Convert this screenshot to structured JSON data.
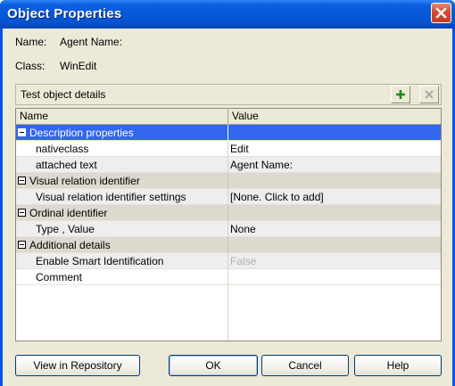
{
  "window": {
    "title": "Object Properties"
  },
  "info": {
    "name_label": "Name:",
    "name_value": "Agent Name:",
    "class_label": "Class:",
    "class_value": "WinEdit"
  },
  "panel": {
    "title": "Test object details",
    "add_icon": "plus-icon",
    "remove_icon": "x-icon"
  },
  "grid": {
    "columns": [
      "Name",
      "Value"
    ],
    "rows": [
      {
        "type": "category",
        "name": "Description properties",
        "value": ""
      },
      {
        "type": "prop",
        "name": "nativeclass",
        "value": "Edit"
      },
      {
        "type": "prop",
        "name": "attached text",
        "value": "Agent Name:"
      },
      {
        "type": "category",
        "name": "Visual relation identifier",
        "value": ""
      },
      {
        "type": "prop",
        "name": "Visual relation identifier settings",
        "value": "[None. Click to add]"
      },
      {
        "type": "category",
        "name": "Ordinal identifier",
        "value": ""
      },
      {
        "type": "prop",
        "name": "Type , Value",
        "value": "None"
      },
      {
        "type": "category",
        "name": "Additional details",
        "value": ""
      },
      {
        "type": "prop",
        "name": "Enable Smart Identification",
        "value": "False"
      },
      {
        "type": "prop",
        "name": "Comment",
        "value": ""
      }
    ]
  },
  "buttons": {
    "view_repo": "View in Repository",
    "ok": "OK",
    "cancel": "Cancel",
    "help": "Help"
  },
  "colors": {
    "titlebar": "#0458d8",
    "selection": "#3366ee",
    "category_bg": "#ddd9cf",
    "dialog_bg": "#ece9d8"
  }
}
